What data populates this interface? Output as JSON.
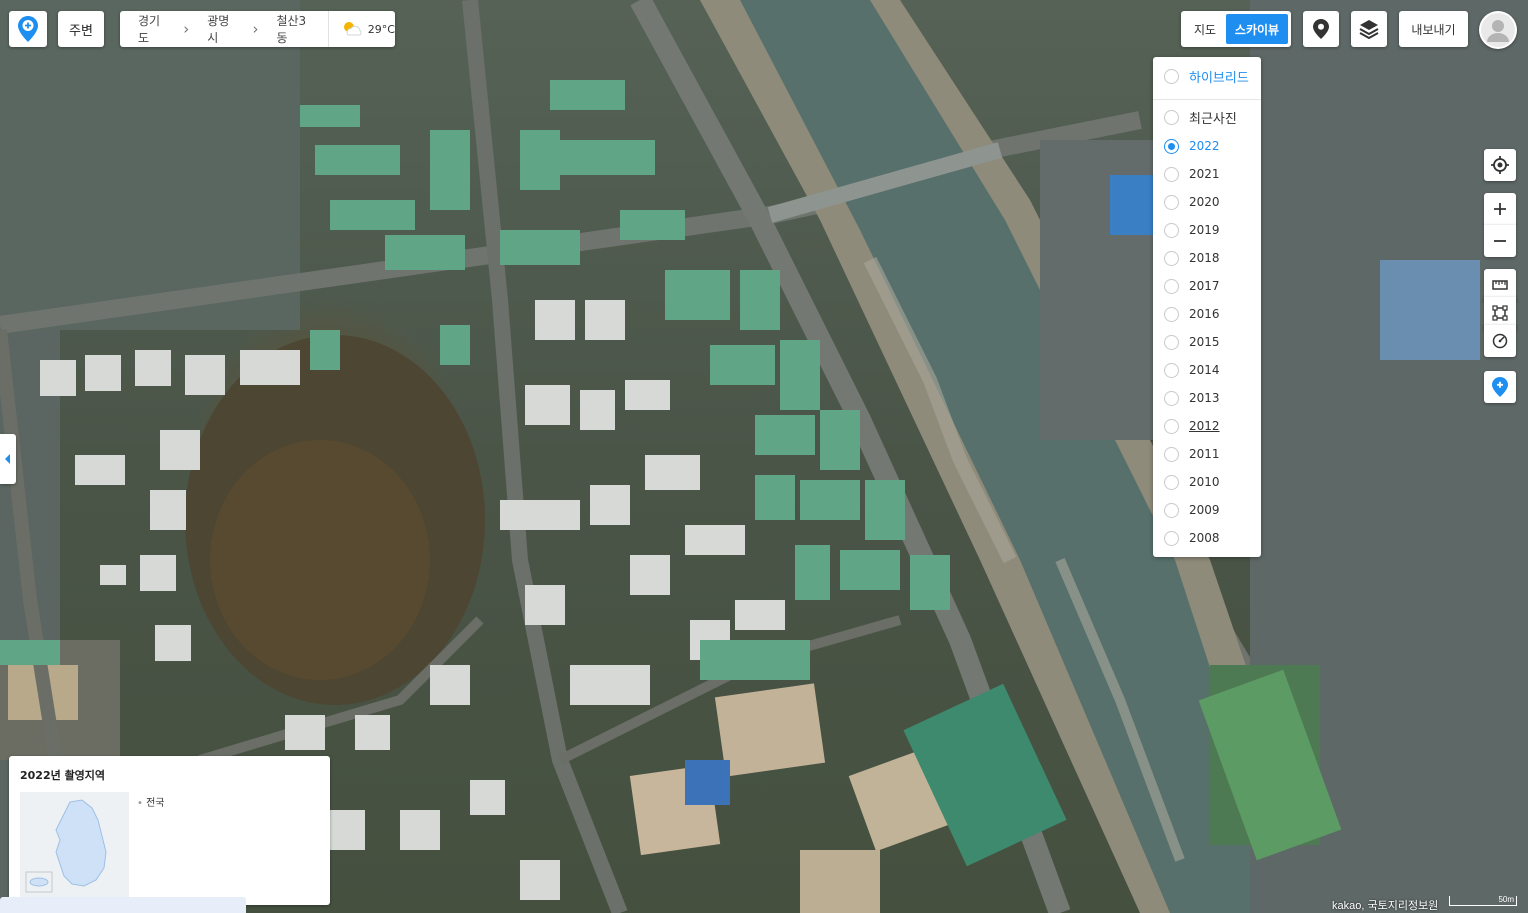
{
  "top_left": {
    "nearby_label": "주변",
    "breadcrumb": [
      "경기도",
      "광명시",
      "철산3동"
    ],
    "temperature": "29°C",
    "weather_icon": "partly-cloudy-icon"
  },
  "top_right": {
    "map_type_map": "지도",
    "map_type_skyview": "스카이뷰",
    "export_label": "내보내기"
  },
  "year_panel": {
    "hybrid": "하이브리드",
    "recent": "최근사진",
    "selected": "2022",
    "years": [
      "2022",
      "2021",
      "2020",
      "2019",
      "2018",
      "2017",
      "2016",
      "2015",
      "2014",
      "2013",
      "2012",
      "2011",
      "2010",
      "2009",
      "2008"
    ]
  },
  "coverage": {
    "title": "2022년 촬영지역",
    "region": "전국"
  },
  "footer": {
    "copyright": "kakao, 국토지리정보원",
    "scale": "50m"
  },
  "colors": {
    "accent": "#1e8ef0"
  }
}
